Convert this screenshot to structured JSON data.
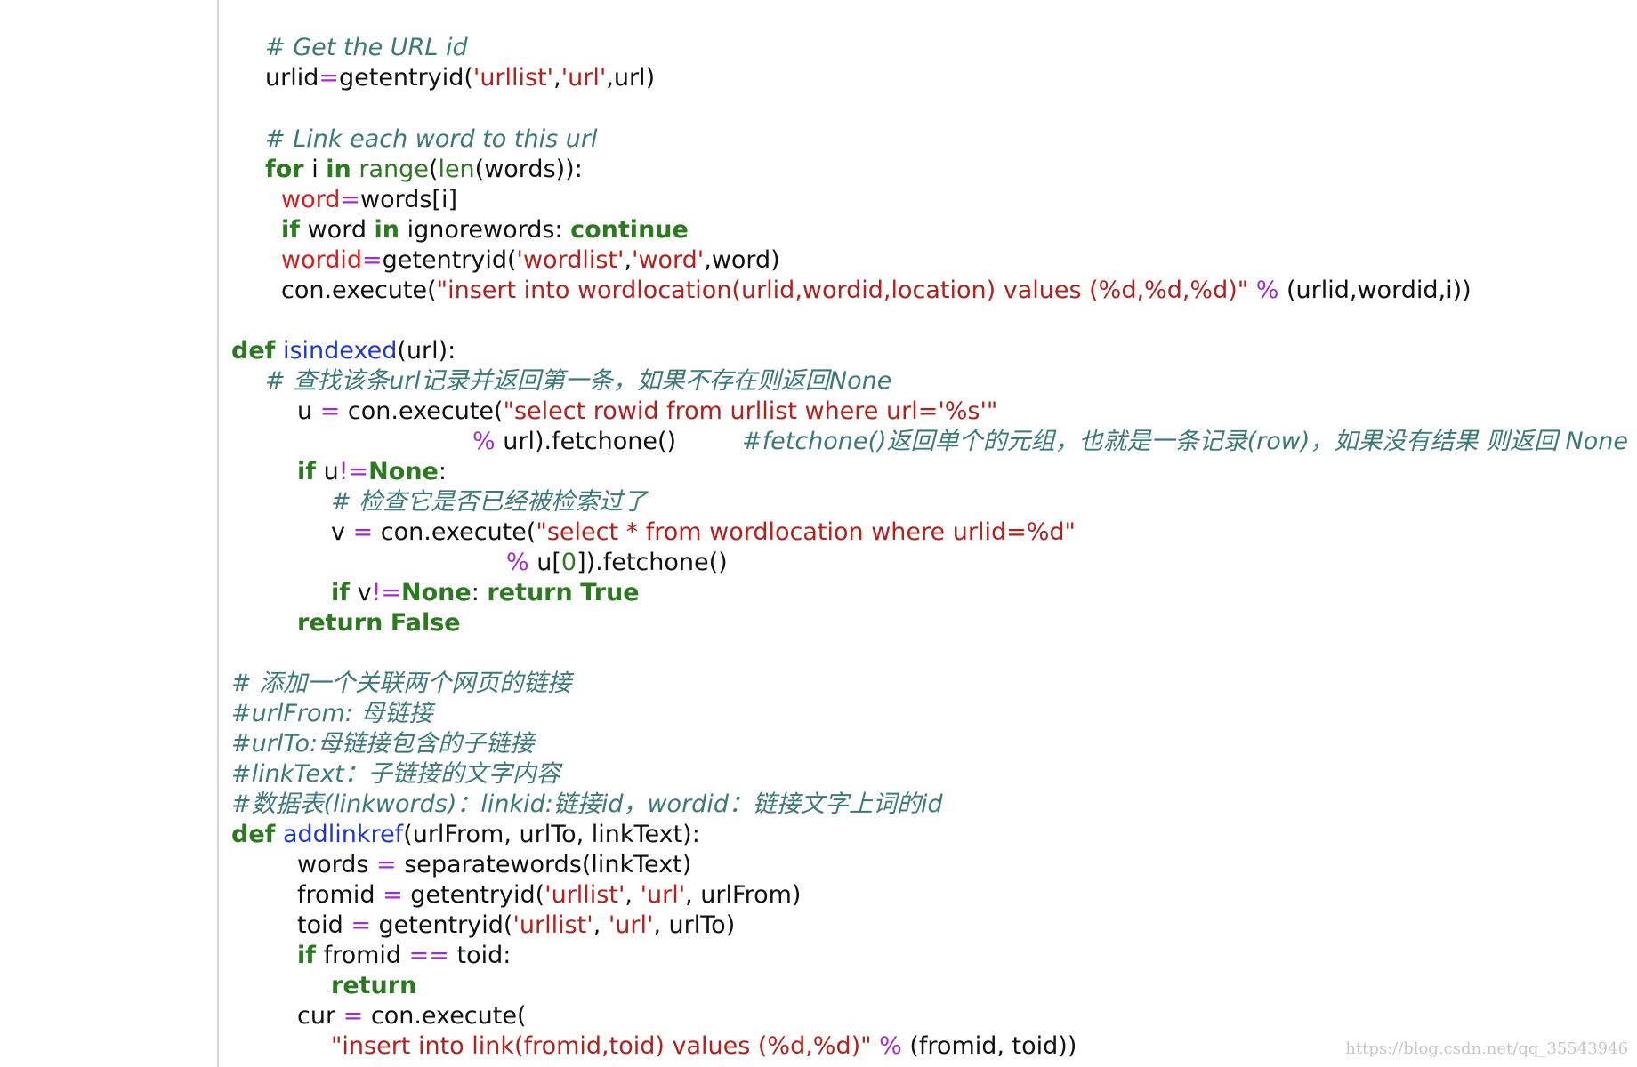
{
  "editor": {
    "watermark": "https://blog.csdn.net/qq_35543946"
  },
  "code": {
    "l01_cm": "# Get the URL id",
    "l02_a": "urlid",
    "l02_op": "=",
    "l02_b": "getentryid(",
    "l02_s1": "'urllist'",
    "l02_c": ",",
    "l02_s2": "'url'",
    "l02_d": ",url)",
    "l03_cm": "# Link each word to this url",
    "l04_kw1": "for",
    "l04_a": " i ",
    "l04_kw2": "in",
    "l04_b": " ",
    "l04_bi1": "range",
    "l04_c": "(",
    "l04_bi2": "len",
    "l04_d": "(words)):",
    "l05_var": "word",
    "l05_op": "=",
    "l05_a": "words[i]",
    "l06_kw1": "if",
    "l06_a": " word ",
    "l06_kw2": "in",
    "l06_b": " ignorewords: ",
    "l06_kw3": "continue",
    "l07_var": "wordid",
    "l07_op": "=",
    "l07_a": "getentryid(",
    "l07_s1": "'wordlist'",
    "l07_b": ",",
    "l07_s2": "'word'",
    "l07_c": ",word)",
    "l08_a": "con.execute(",
    "l08_s": "\"insert into wordlocation(urlid,wordid,location) values (%d,%d,%d)\"",
    "l08_b": " ",
    "l08_op": "%",
    "l08_c": " (urlid,wordid,i))",
    "l09_kw": "def",
    "l09_a": " ",
    "l09_fn": "isindexed",
    "l09_b": "(url):",
    "l10_cm": "# 查找该条url记录并返回第一条，如果不存在则返回None",
    "l11_a": "u ",
    "l11_op": "=",
    "l11_b": " con.execute(",
    "l11_s": "\"select rowid from urllist where url='%s'\"",
    "l12_op": "%",
    "l12_a": " url).fetchone()",
    "l12_cm": "#fetchone()返回单个的元组，也就是一条记录(row)，如果没有结果 则返回 None",
    "l13_kw": "if",
    "l13_a": " u",
    "l13_op": "!=",
    "l13_nm": "None",
    "l13_b": ":",
    "l14_cm": "# 检查它是否已经被检索过了",
    "l15_a": "v ",
    "l15_op": "=",
    "l15_b": " con.execute(",
    "l15_s": "\"select * from wordlocation where urlid=%d\"",
    "l16_op": "%",
    "l16_a": " u[",
    "l16_nm": "0",
    "l16_b": "]).fetchone()",
    "l17_kw1": "if",
    "l17_a": " v",
    "l17_op": "!=",
    "l17_nm": "None",
    "l17_b": ": ",
    "l17_kw2": "return",
    "l17_c": " ",
    "l17_kw3": "True",
    "l18_kw1": "return",
    "l18_a": " ",
    "l18_kw2": "False",
    "l19_cm": "# 添加一个关联两个网页的链接",
    "l20_cm": "#urlFrom: 母链接",
    "l21_cm": "#urlTo:母链接包含的子链接",
    "l22_cm": "#linkText：子链接的文字内容",
    "l23_cm": "#数据表(linkwords)：linkid:链接id，wordid：链接文字上词的id",
    "l24_kw": "def",
    "l24_a": " ",
    "l24_fn": "addlinkref",
    "l24_b": "(urlFrom, urlTo, linkText):",
    "l25_a": "words ",
    "l25_op": "=",
    "l25_b": " separatewords(linkText)",
    "l26_a": "fromid ",
    "l26_op": "=",
    "l26_b": " getentryid(",
    "l26_s1": "'urllist'",
    "l26_c": ", ",
    "l26_s2": "'url'",
    "l26_d": ", urlFrom)",
    "l27_a": "toid ",
    "l27_op": "=",
    "l27_b": " getentryid(",
    "l27_s1": "'urllist'",
    "l27_c": ", ",
    "l27_s2": "'url'",
    "l27_d": ", urlTo)",
    "l28_kw": "if",
    "l28_a": " fromid ",
    "l28_op": "==",
    "l28_b": " toid:",
    "l29_kw": "return",
    "l30_a": "cur ",
    "l30_op": "=",
    "l30_b": " con.execute(",
    "l31_s": "\"insert into link(fromid,toid) values (%d,%d)\"",
    "l31_a": " ",
    "l31_op": "%",
    "l31_b": " (fromid, toid))"
  }
}
